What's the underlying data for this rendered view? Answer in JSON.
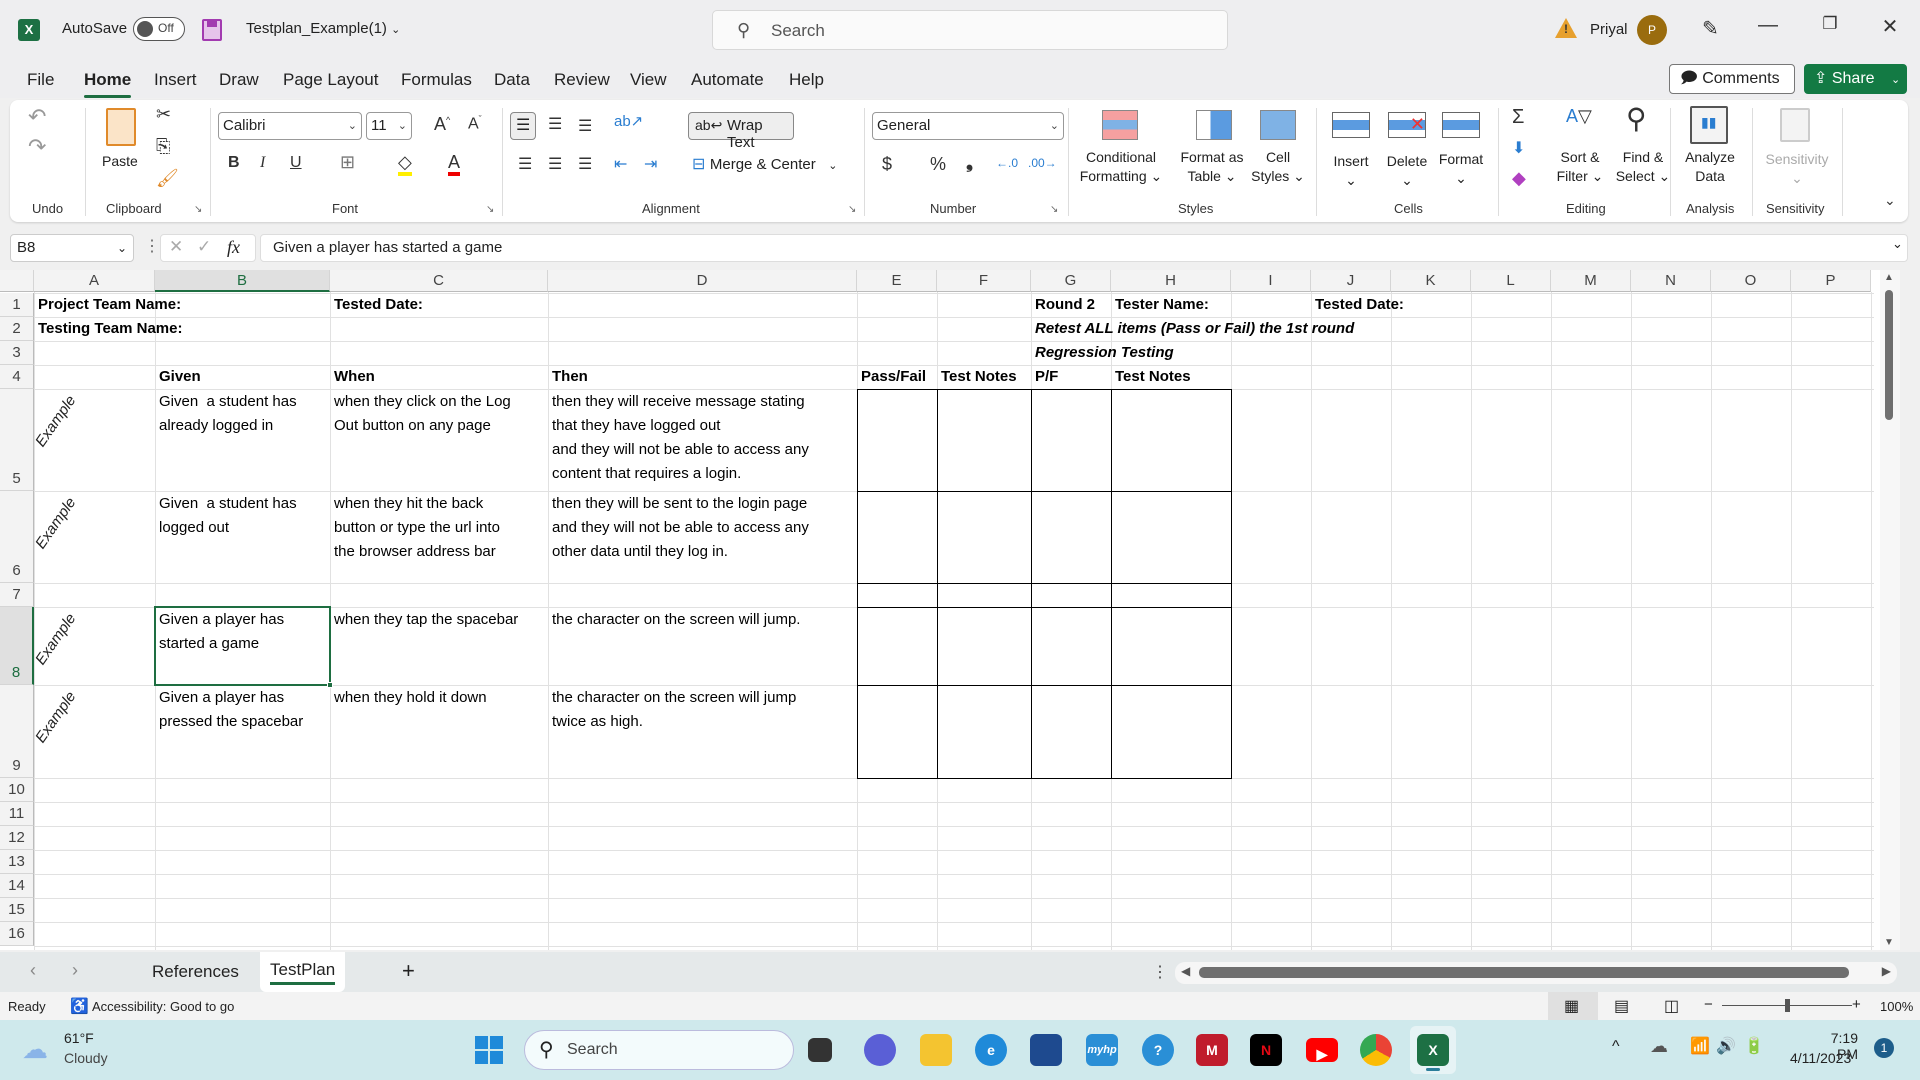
{
  "titlebar": {
    "autosave_label": "AutoSave",
    "autosave_state": "Off",
    "filename": "Testplan_Example(1)",
    "search_placeholder": "Search",
    "user_name": "Priyal",
    "user_initial": "P",
    "minimize": "—",
    "restore": "❐",
    "close": "✕"
  },
  "menu": {
    "tabs": [
      "File",
      "Home",
      "Insert",
      "Draw",
      "Page Layout",
      "Formulas",
      "Data",
      "Review",
      "View",
      "Automate",
      "Help"
    ],
    "active": "Home",
    "comments_label": "Comments",
    "share_label": "Share"
  },
  "ribbon": {
    "groups": {
      "undo": "Undo",
      "clipboard": "Clipboard",
      "font": "Font",
      "alignment": "Alignment",
      "number": "Number",
      "styles": "Styles",
      "cells": "Cells",
      "editing": "Editing",
      "analysis": "Analysis",
      "sensitivity": "Sensitivity"
    },
    "paste_label": "Paste",
    "font_name": "Calibri",
    "font_size": "11",
    "wrap_text": "Wrap Text",
    "merge_center": "Merge & Center",
    "number_format": "General",
    "conditional_formatting": [
      "Conditional",
      "Formatting"
    ],
    "format_as_table": [
      "Format as",
      "Table"
    ],
    "cell_styles": [
      "Cell",
      "Styles"
    ],
    "insert": "Insert",
    "delete": "Delete",
    "format": "Format",
    "sort_filter": [
      "Sort &",
      "Filter"
    ],
    "find_select": [
      "Find &",
      "Select"
    ],
    "analyze_data": [
      "Analyze",
      "Data"
    ],
    "sensitivity_btn": "Sensitivity"
  },
  "formula_bar": {
    "name_box": "B8",
    "formula": "Given a player has started a game"
  },
  "sheet": {
    "columns": [
      "A",
      "B",
      "C",
      "D",
      "E",
      "F",
      "G",
      "H",
      "I",
      "J",
      "K",
      "L",
      "M",
      "N",
      "O",
      "P"
    ],
    "selected_column": "B",
    "selected_row": "8",
    "rows": [
      "1",
      "2",
      "3",
      "4",
      "5",
      "6",
      "7",
      "8",
      "9",
      "10",
      "11",
      "12",
      "13",
      "14",
      "15",
      "16"
    ],
    "cells": {
      "A1": "Project Team Name:",
      "C1": "Tested Date:",
      "G1": "Round 2",
      "H1": "Tester Name:",
      "J1": "Tested  Date:",
      "A2": "Testing Team Name:",
      "G2": "Retest ALL items (Pass or Fail) the 1st round",
      "G3": "Regression Testing",
      "B4": "Given",
      "C4": "When",
      "D4": "Then",
      "E4": "Pass/Fail",
      "F4": "Test Notes",
      "G4": "P/F",
      "H4": "Test Notes"
    },
    "test_cases": [
      {
        "row": "5",
        "label": "Example",
        "given": "Given  a student has\nalready logged in",
        "when": "when they click on the Log\nOut button on any page",
        "then": "then they will receive message stating\nthat they have logged out\nand they will not be able to access any\ncontent that requires a login."
      },
      {
        "row": "6",
        "label": "Example",
        "given": "Given  a student has\nlogged out",
        "when": "when they hit the back\nbutton or type the url into\nthe browser address bar",
        "then": "then they will be sent to the login page\nand they will not be able to access any\nother data until they log in."
      },
      {
        "row": "8",
        "label": "Example",
        "given": "Given a player has\nstarted a game",
        "when": "when they tap the spacebar",
        "then": "the character on the screen will jump."
      },
      {
        "row": "9",
        "label": "Example",
        "given": "Given a player has\npressed the spacebar",
        "when": "when they hold it down",
        "then": "the character on the screen will jump\ntwice as high."
      }
    ]
  },
  "sheet_tabs": {
    "tabs": [
      "References",
      "TestPlan"
    ],
    "active": "TestPlan",
    "add": "+"
  },
  "status": {
    "ready": "Ready",
    "accessibility": "Accessibility: Good to go",
    "zoom": "100%",
    "zoom_fraction": 0.5
  },
  "taskbar": {
    "weather_temp": "61°F",
    "weather_desc": "Cloudy",
    "search_placeholder": "Search",
    "time": "7:19 PM",
    "date": "4/11/2023",
    "notification_count": "1"
  },
  "colors": {
    "excel_green": "#1e6e41",
    "share_green": "#137a44",
    "avatar": "#9a6c0e"
  }
}
